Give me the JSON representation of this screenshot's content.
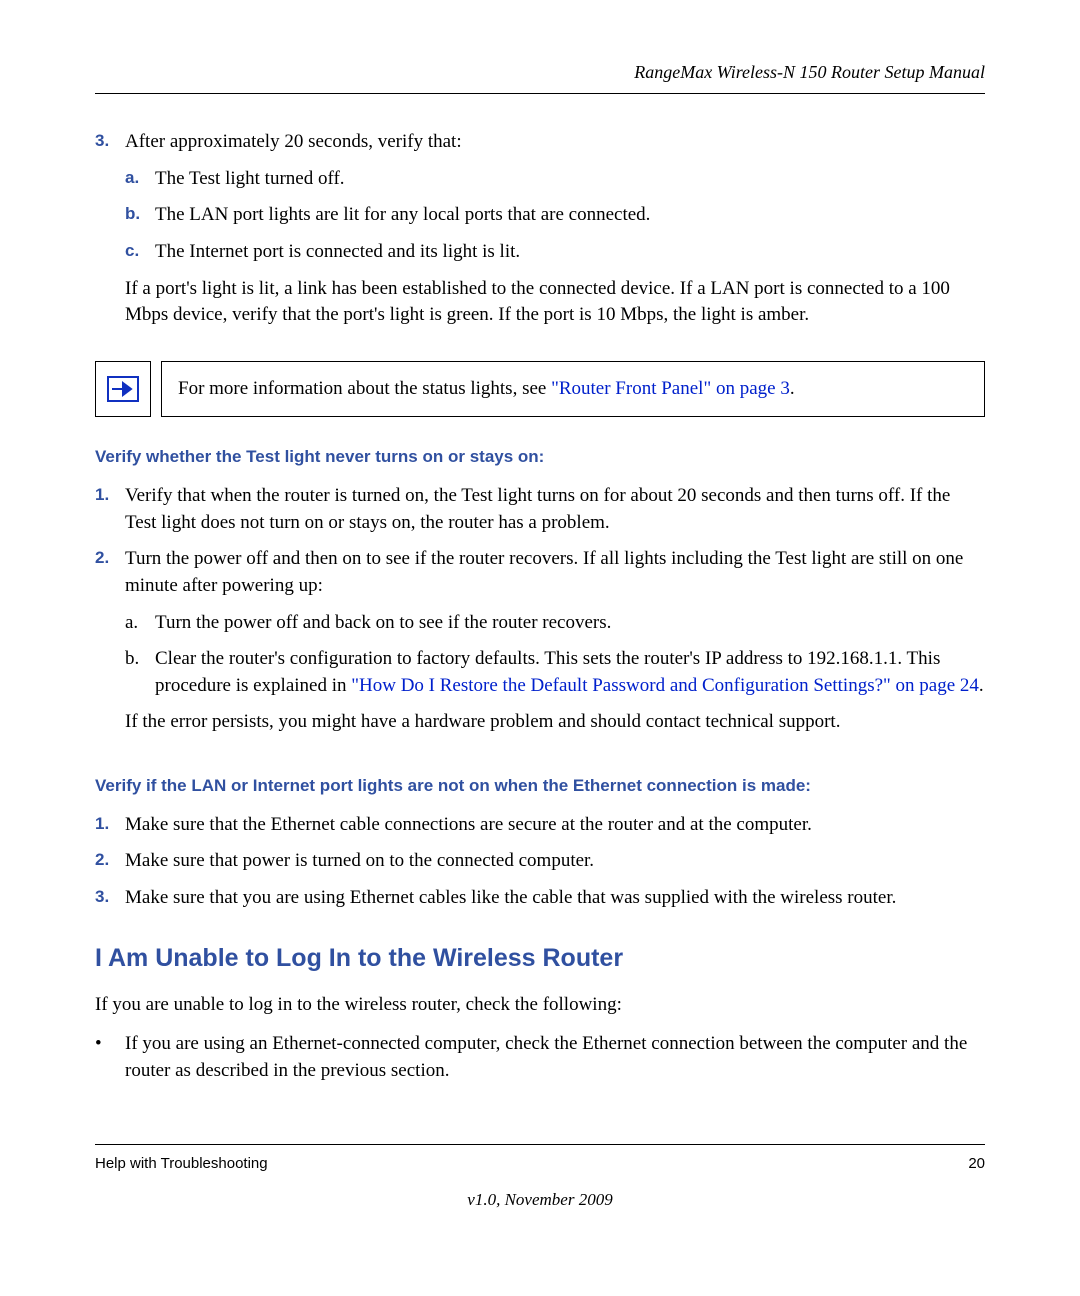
{
  "header": "RangeMax Wireless-N 150 Router Setup Manual",
  "main_list": {
    "item3": {
      "num": "3.",
      "text": "After approximately 20 seconds, verify that:",
      "sub": {
        "a": {
          "letter": "a.",
          "text": "The Test light turned off."
        },
        "b": {
          "letter": "b.",
          "text": "The LAN port lights are lit for any local ports that are connected."
        },
        "c": {
          "letter": "c.",
          "text": "The Internet port is connected and its light is lit."
        }
      },
      "para": "If a port's light is lit, a link has been established to the connected device. If a LAN port is connected to a 100 Mbps device, verify that the port's light is green. If the port is 10 Mbps, the light is amber."
    }
  },
  "note": {
    "pre": "For more information about the status lights, see ",
    "link": "\"Router Front Panel\" on page 3",
    "post": "."
  },
  "section1": {
    "heading": "Verify whether the Test light never turns on or stays on:",
    "item1": {
      "num": "1.",
      "text": "Verify that when the router is turned on, the Test light turns on for about 20 seconds and then turns off. If the Test light does not turn on or stays on, the router has a problem."
    },
    "item2": {
      "num": "2.",
      "text": "Turn the power off and then on to see if the router recovers. If all lights including the Test light are still on one minute after powering up:",
      "sub": {
        "a": {
          "letter": "a.",
          "text": "Turn the power off and back on to see if the router recovers."
        },
        "b": {
          "letter": "b.",
          "pre": "Clear the router's configuration to factory defaults. This sets the router's IP address to 192.168.1.1. This procedure is explained in ",
          "link": "\"How Do I Restore the Default Password and Configuration Settings?\" on page 24",
          "post": "."
        }
      },
      "para": "If the error persists, you might have a hardware problem and should contact technical support."
    }
  },
  "section2": {
    "heading": "Verify if the LAN or Internet port lights are not on when the Ethernet connection is made:",
    "item1": {
      "num": "1.",
      "text": "Make sure that the Ethernet cable connections are secure at the router and at the computer."
    },
    "item2": {
      "num": "2.",
      "text": "Make sure that power is turned on to the connected computer."
    },
    "item3": {
      "num": "3.",
      "text": "Make sure that you are using Ethernet cables like the cable that was supplied with the wireless router."
    }
  },
  "h2": "I Am Unable to Log In to the Wireless Router",
  "h2_para": "If you are unable to log in to the wireless router, check the following:",
  "bullet1": "If you are using an Ethernet-connected computer, check the Ethernet connection between the computer and the router as described in the previous section.",
  "footer": {
    "left": "Help with Troubleshooting",
    "right": "20",
    "version": "v1.0, November 2009"
  }
}
